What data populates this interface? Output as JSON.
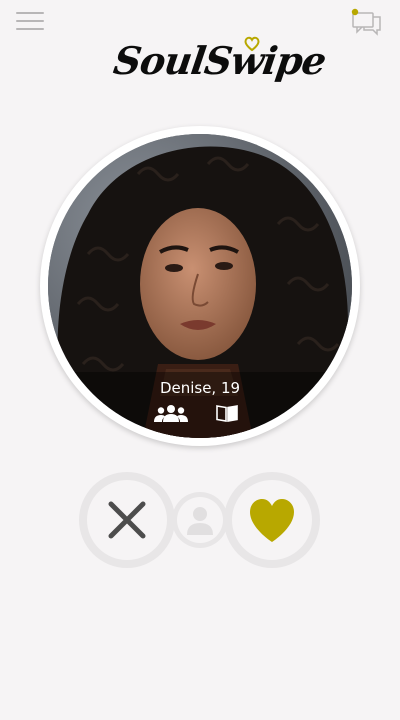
{
  "header": {
    "menu_icon": "hamburger-menu-icon",
    "chat_icon": "chat-bubbles-icon",
    "notification_dot_color": "#b8a800"
  },
  "logo": {
    "text": "SoulSwipe",
    "heart_color": "#b8a800"
  },
  "profile": {
    "name_age": "Denise, 19",
    "icons": [
      "friends-icon",
      "book-icon"
    ]
  },
  "actions": {
    "reject_icon": "x-icon",
    "profile_icon": "user-silhouette-icon",
    "like_icon": "heart-icon",
    "accent_color": "#b8a800"
  }
}
